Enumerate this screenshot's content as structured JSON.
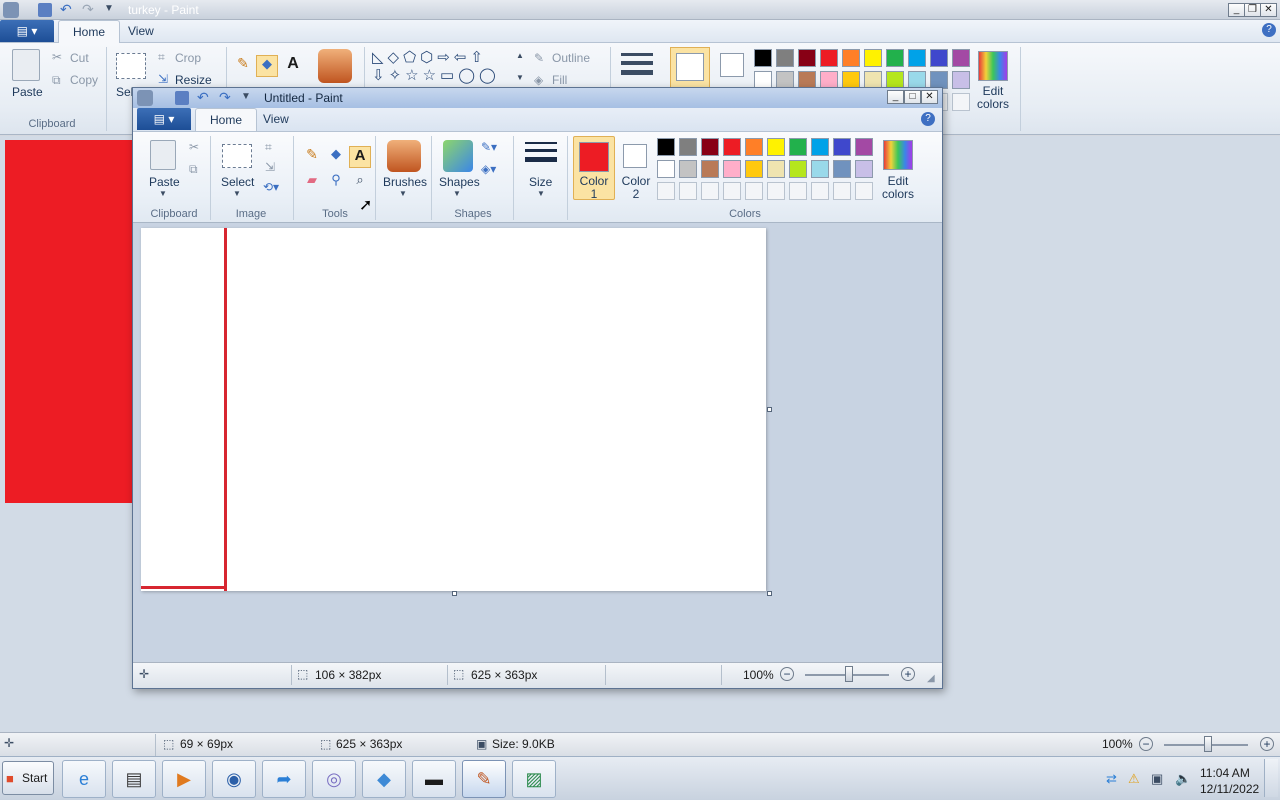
{
  "bg_window": {
    "title": "turkey - Paint",
    "tabs": [
      "Home",
      "View"
    ],
    "clipboard": {
      "paste": "Paste",
      "cut": "Cut",
      "copy": "Copy",
      "group": "Clipboard"
    },
    "image": {
      "crop": "Crop",
      "resize": "Resize",
      "select": "Sel"
    },
    "outline": "Outline",
    "fill": "Fill",
    "edit_colors": "Edit colors",
    "status": {
      "selection": "69 × 69px",
      "canvas": "625 × 363px",
      "size": "Size: 9.0KB",
      "zoom": "100%"
    }
  },
  "fg_window": {
    "title": "Untitled - Paint",
    "tabs": [
      "Home",
      "View"
    ],
    "groups": {
      "clipboard": "Clipboard",
      "image": "Image",
      "tools": "Tools",
      "shapes": "Shapes",
      "colors": "Colors"
    },
    "buttons": {
      "paste": "Paste",
      "select": "Select",
      "brushes": "Brushes",
      "shapes": "Shapes",
      "size": "Size",
      "color1": "Color 1",
      "color2": "Color 2",
      "edit_colors": "Edit colors"
    },
    "status": {
      "selection": "106 × 382px",
      "canvas": "625 × 363px",
      "zoom": "100%"
    }
  },
  "palette_row1": [
    "#000000",
    "#7f7f7f",
    "#880015",
    "#ed1c24",
    "#ff7f27",
    "#fff200",
    "#22b14c",
    "#00a2e8",
    "#3f48cc",
    "#a349a4"
  ],
  "palette_row2": [
    "#ffffff",
    "#c3c3c3",
    "#b97a57",
    "#ffaec9",
    "#ffc90e",
    "#efe4b0",
    "#b5e61d",
    "#99d9ea",
    "#7092be",
    "#c8bfe7"
  ],
  "colors": {
    "primary": "#ed1c24",
    "secondary": "#ffffff",
    "accent": "#1d4e96"
  },
  "taskbar": {
    "start": "Start",
    "time": "11:04 AM",
    "date": "12/11/2022"
  }
}
